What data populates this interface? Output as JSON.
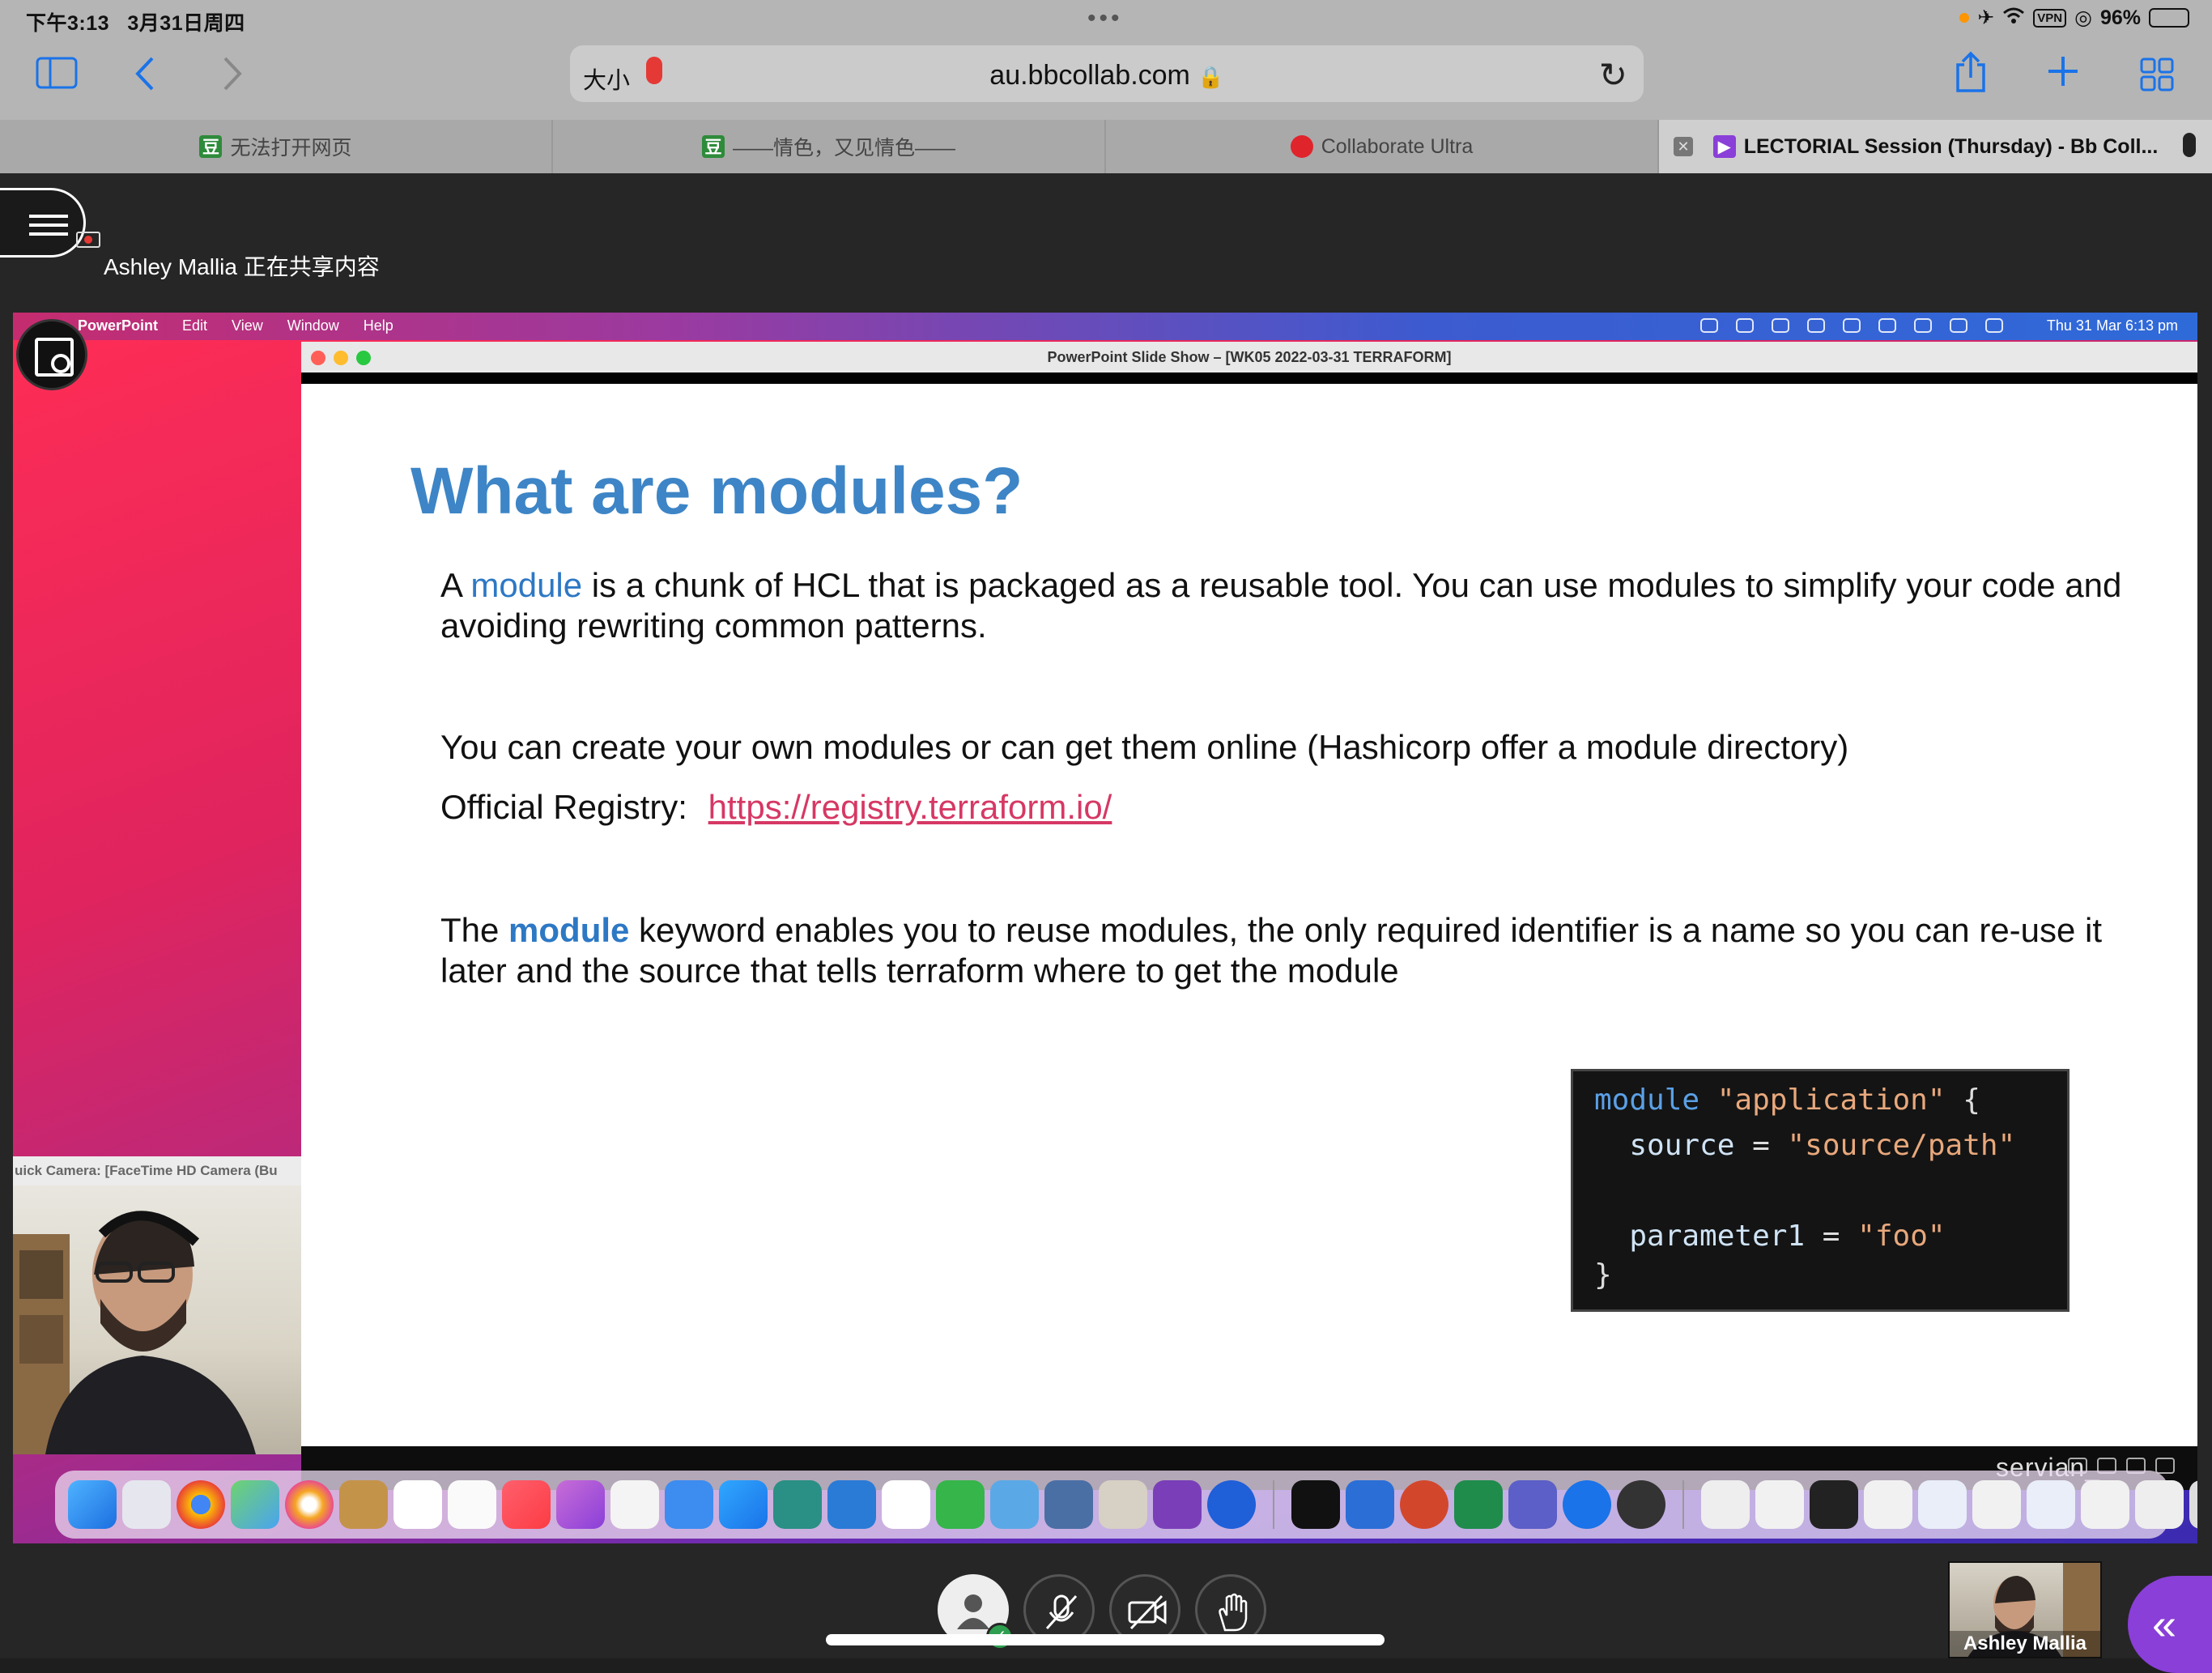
{
  "status_bar": {
    "time": "下午3:13",
    "date": "3月31日周四",
    "dots": "•••",
    "vpn": "VPN",
    "battery": "96%"
  },
  "toolbar": {
    "text_size": "大小",
    "url": "au.bbcollab.com"
  },
  "tabs": [
    {
      "label": "无法打开网页",
      "favicon": "豆",
      "favicon_color": "#2e8b3a"
    },
    {
      "label": "——情色，又见情色——",
      "favicon": "豆",
      "favicon_color": "#2e8b3a"
    },
    {
      "label": "Collaborate Ultra",
      "favicon": "",
      "favicon_color": "#e0242c"
    },
    {
      "label": "LECTORIAL Session (Thursday) - Bb Coll...",
      "favicon": "",
      "favicon_color": "#8a3fd8",
      "active": true
    }
  ],
  "collab": {
    "share_label": "Ashley Mallia 正在共享内容",
    "participant_name": "Ashley Mallia",
    "accent_color": "#8a3fd8"
  },
  "mac": {
    "app": "PowerPoint",
    "menus": [
      "Edit",
      "View",
      "Window",
      "Help"
    ],
    "clock": "Thu 31 Mar  6:13 pm",
    "window_title": "PowerPoint Slide Show – [WK05 2022-03-31 TERRAFORM]",
    "camera_label": "uick Camera: [FaceTime HD Camera (Bu"
  },
  "slide": {
    "title": "What are modules?",
    "p1_a": "A ",
    "p1_kw": "module",
    "p1_b": " is a chunk of HCL that is packaged as a reusable tool. You can use modules to simplify your code and avoiding rewriting common patterns.",
    "p2": "You can create your own modules or can get them online (Hashicorp offer a module directory)",
    "p3_label": "Official Registry:",
    "p3_link": "https://registry.terraform.io/",
    "p4_a": "The ",
    "p4_kw": "module",
    "p4_b": " keyword enables you to reuse modules, the only required identifier is a name so you can re-use it later and the source that tells terraform where to get the module",
    "code": {
      "l1_kw": "module",
      "l1_str": "\"application\"",
      "l1_brace": "{",
      "l2_prop": "source",
      "l2_op": "=",
      "l2_str": "\"source/path\"",
      "l3_prop": "parameter1",
      "l3_op": "=",
      "l3_str": "\"foo\"",
      "l4_brace": "}"
    },
    "footer_logo": "servian_"
  }
}
